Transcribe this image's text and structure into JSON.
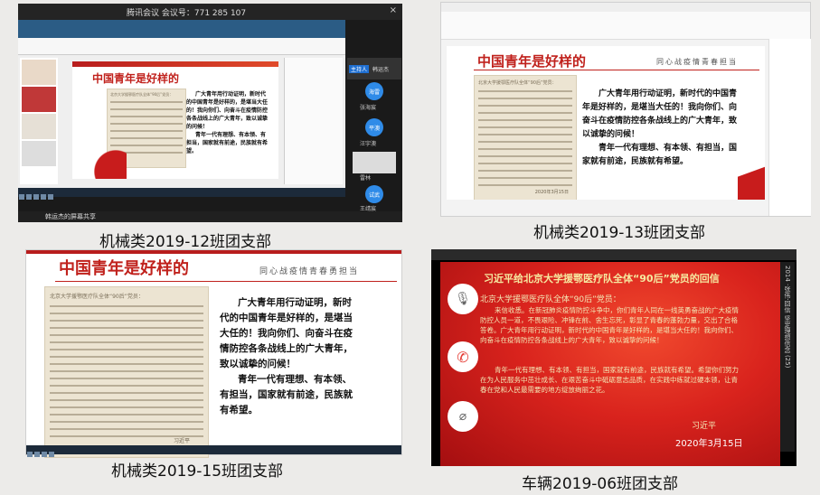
{
  "panels": [
    {
      "caption": "机械类2019-12班团支部",
      "app_title": "腾讯会议 会议号：771 285 107",
      "slide": {
        "title": "中国青年是好样的",
        "letter_header": "北京大学援鄂医疗队全体“90后”党员：",
        "body": [
          "广大青年用行动证明，新时代的中国青年是好样的，是堪当大任的！我向你们、向奋斗在疫情防控各条战线上的广大青年，致以诚挚的问候！",
          "青年一代有理想、有本领、有担当，国家就有前途，民族就有希望。"
        ]
      },
      "participants": [
        "韩运杰",
        "海雷",
        "张海宸",
        "平澳",
        "汪宇澳",
        "雷林",
        "试武",
        "王靖宸"
      ],
      "share_bar": "韩运杰的屏幕共享",
      "host_badge": "主持人"
    },
    {
      "caption": "机械类2019-13班团支部",
      "slide": {
        "title": "中国青年是好样的",
        "slogan": "同心战疫情青春担当",
        "letter_header": "北京大学援鄂医疗队全体“90后”党员：",
        "body": [
          "广大青年用行动证明，新时代的中国青年是好样的，是堪当大任的！我向你们、向奋斗在疫情防控各条战线上的广大青年，致以诚挚的问候！",
          "青年一代有理想、有本领、有担当，国家就有前途，民族就有希望。"
        ],
        "letter_date": "2020年3月15日"
      }
    },
    {
      "caption": "机械类2019-15班团支部",
      "slide": {
        "title": "中国青年是好样的",
        "slogan": "同心战疫情青春勇担当",
        "letter_header": "北京大学援鄂医疗队全体“90后”党员：",
        "body_p1": [
          "广大青年用行动证明，新时",
          "代的中国青年是好样的，是堪当",
          "大任的！我向你们、向奋斗在疫",
          "情防控各条战线上的广大青年，",
          "致以诚挚的问候！"
        ],
        "body_p2": [
          "青年一代有理想、有本领、",
          "有担当，国家就有前途，民族就",
          "有希望。"
        ],
        "signature": "习近平"
      }
    },
    {
      "caption": "车辆2019-06班团支部",
      "letter_title": "习近平给北京大学援鄂医疗队全体“90后”党员的回信",
      "salutation": "北京大学援鄂医疗队全体“90后”党员：",
      "paragraph1": "来信收悉。在新冠肺炎疫情防控斗争中，你们青年人同在一线英勇奋战的广大疫情防控人员一道，不畏艰险、冲锋在前、舍生忘死，彰显了青春的蓬勃力量，交出了合格答卷。广大青年用行动证明，新时代的中国青年是好样的，是堪当大任的！我向你们、向奋斗在疫情防控各条战线上的广大青年，致以诚挚的问候！",
      "paragraph2": "青年一代有理想、有本领、有担当，国家就有前途，民族就有希望。希望你们努力在为人民服务中茁壮成长、在艰苦奋斗中砥砺意志品质，在实践中练就过硬本领，让青春在党和人民最需要的地方绽放绚丽之花。",
      "signature": "习近平",
      "date": "2020年3月15日",
      "side_text": "2014 ·张伟·回信  坚定理想信念 (25)"
    }
  ]
}
